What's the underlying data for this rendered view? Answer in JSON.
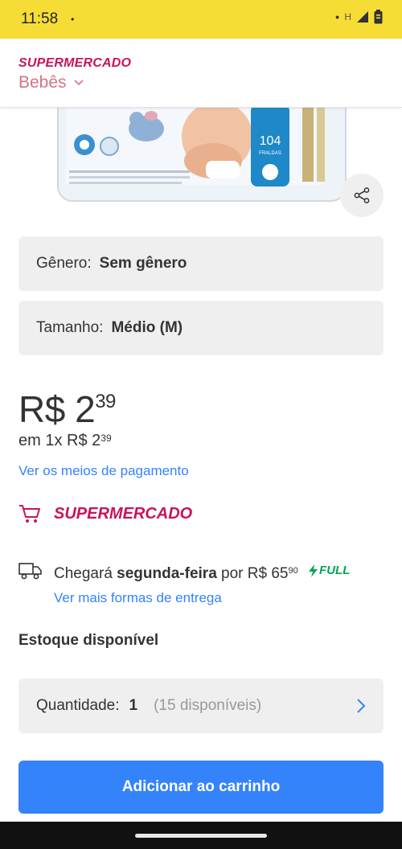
{
  "status_bar": {
    "time": "11:58",
    "dot": "•",
    "network": "H"
  },
  "header": {
    "brand": "SUPERMERCADO",
    "category": "Bebês"
  },
  "product": {
    "image_icon": "diaper-package-image",
    "share_icon": "share-icon"
  },
  "attributes": [
    {
      "label": "Gênero:",
      "value": "Sem gênero"
    },
    {
      "label": "Tamanho:",
      "value": "Médio (M)"
    }
  ],
  "price": {
    "currency": "R$",
    "integer": "2",
    "cents": "39",
    "installment_prefix": "em 1x R$ 2",
    "installment_cents": "39",
    "payment_link": "Ver os meios de pagamento"
  },
  "seller": {
    "icon": "cart-icon",
    "name": "SUPERMERCADO"
  },
  "shipping": {
    "icon": "truck-icon",
    "prefix": "Chegará",
    "day": "segunda-feira",
    "middle": "por R$ 65",
    "cents": "90",
    "badge": "FULL",
    "link": "Ver mais formas de entrega"
  },
  "stock": {
    "title": "Estoque disponível",
    "quantity_label": "Quantidade:",
    "quantity_value": "1",
    "available": "(15 disponíveis)"
  },
  "actions": {
    "add_to_cart": "Adicionar ao carrinho"
  },
  "colors": {
    "status_bar": "#f6dd35",
    "brand": "#c9135b",
    "link": "#3483fa",
    "full_green": "#00a650",
    "box_bg": "#efefef"
  }
}
